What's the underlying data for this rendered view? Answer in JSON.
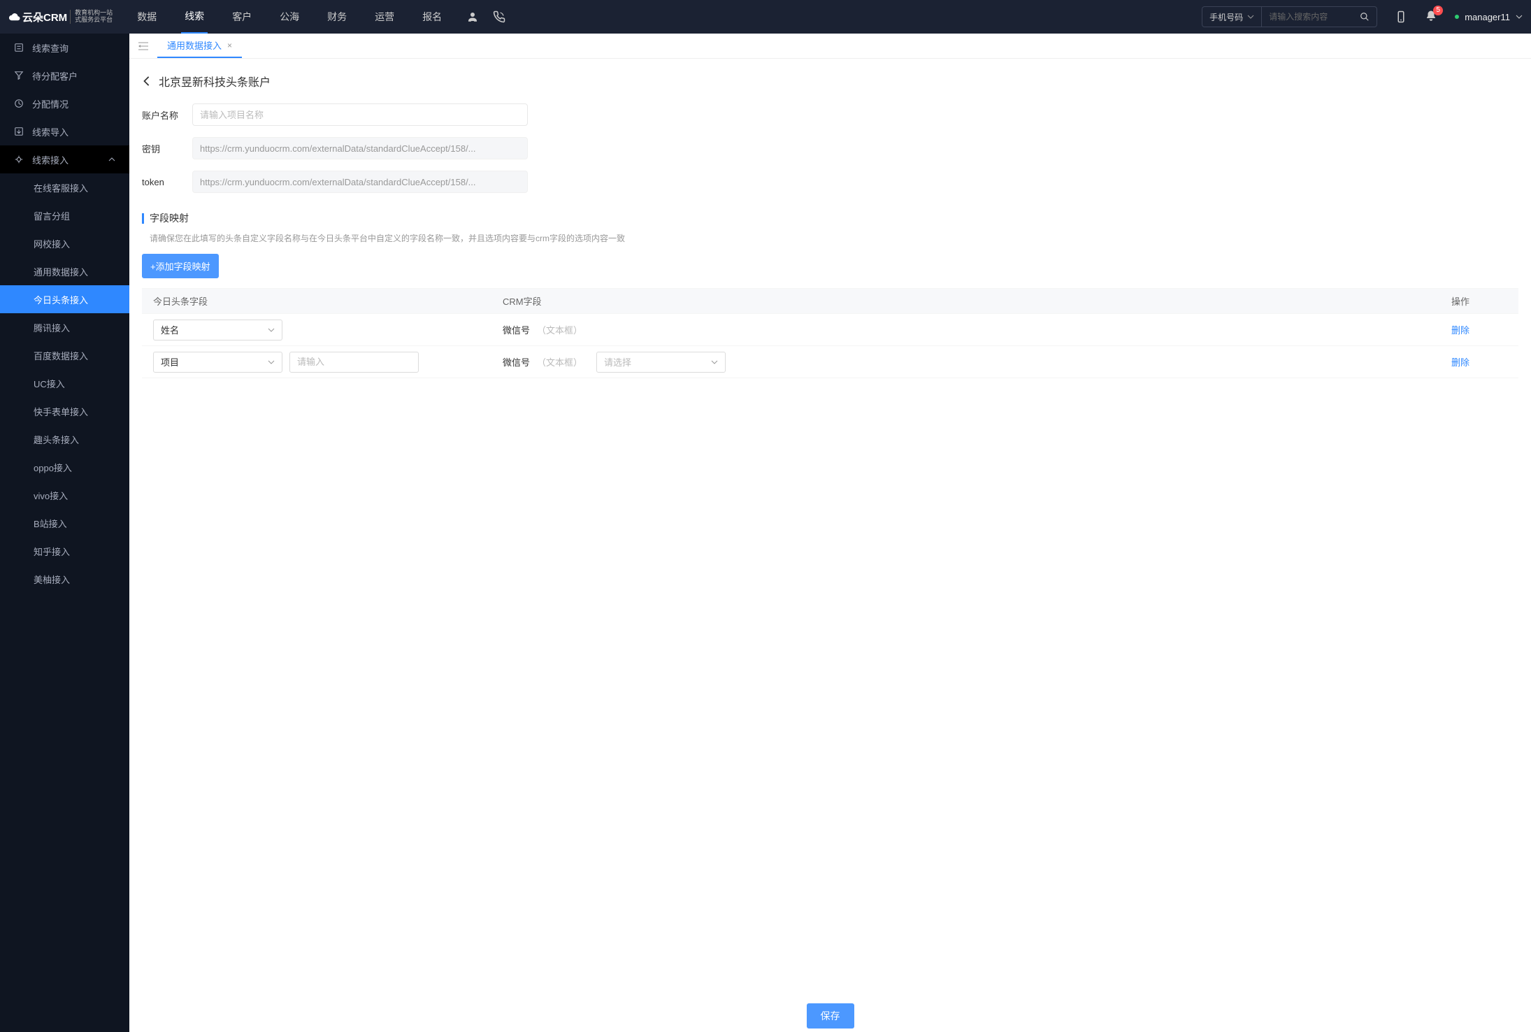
{
  "header": {
    "logo_main": "云朵CRM",
    "logo_sub1": "教育机构一站",
    "logo_sub2": "式服务云平台",
    "nav": [
      {
        "label": "数据",
        "active": false
      },
      {
        "label": "线索",
        "active": true
      },
      {
        "label": "客户",
        "active": false
      },
      {
        "label": "公海",
        "active": false
      },
      {
        "label": "财务",
        "active": false
      },
      {
        "label": "运营",
        "active": false
      },
      {
        "label": "报名",
        "active": false
      }
    ],
    "search_type": "手机号码",
    "search_placeholder": "请输入搜索内容",
    "notif_count": "5",
    "user_name": "manager11"
  },
  "sidebar": {
    "items": [
      {
        "label": "线索查询",
        "icon": "list"
      },
      {
        "label": "待分配客户",
        "icon": "filter"
      },
      {
        "label": "分配情况",
        "icon": "time"
      },
      {
        "label": "线索导入",
        "icon": "export"
      },
      {
        "label": "线索接入",
        "icon": "plug",
        "expanded": true
      }
    ],
    "sub_items": [
      {
        "label": "在线客服接入"
      },
      {
        "label": "留言分组"
      },
      {
        "label": "网校接入"
      },
      {
        "label": "通用数据接入"
      },
      {
        "label": "今日头条接入",
        "active": true
      },
      {
        "label": "腾讯接入"
      },
      {
        "label": "百度数据接入"
      },
      {
        "label": "UC接入"
      },
      {
        "label": "快手表单接入"
      },
      {
        "label": "趣头条接入"
      },
      {
        "label": "oppo接入"
      },
      {
        "label": "vivo接入"
      },
      {
        "label": "B站接入"
      },
      {
        "label": "知乎接入"
      },
      {
        "label": "美柚接入"
      }
    ]
  },
  "tab": {
    "label": "通用数据接入"
  },
  "page": {
    "title": "北京昱新科技头条账户",
    "fields": {
      "account_label": "账户名称",
      "account_placeholder": "请输入项目名称",
      "secret_label": "密钥",
      "secret_value": "https://crm.yunduocrm.com/externalData/standardClueAccept/158/...",
      "token_label": "token",
      "token_value": "https://crm.yunduocrm.com/externalData/standardClueAccept/158/..."
    },
    "section": {
      "title": "字段映射",
      "desc": "请确保您在此填写的头条自定义字段名称与在今日头条平台中自定义的字段名称一致，并且选项内容要与crm字段的选项内容一致",
      "add_btn": "+添加字段映射"
    },
    "table": {
      "col1": "今日头条字段",
      "col2": "CRM字段",
      "col3": "操作",
      "rows": [
        {
          "toutiao_select": "姓名",
          "crm_label": "微信号",
          "crm_hint": "（文本框）",
          "has_extra_input": false,
          "has_crm_select": false,
          "action": "删除"
        },
        {
          "toutiao_select": "项目",
          "extra_input_placeholder": "请输入",
          "crm_label": "微信号",
          "crm_hint": "（文本框）",
          "has_extra_input": true,
          "has_crm_select": true,
          "crm_select_placeholder": "请选择",
          "action": "删除"
        }
      ]
    },
    "save_btn": "保存"
  }
}
